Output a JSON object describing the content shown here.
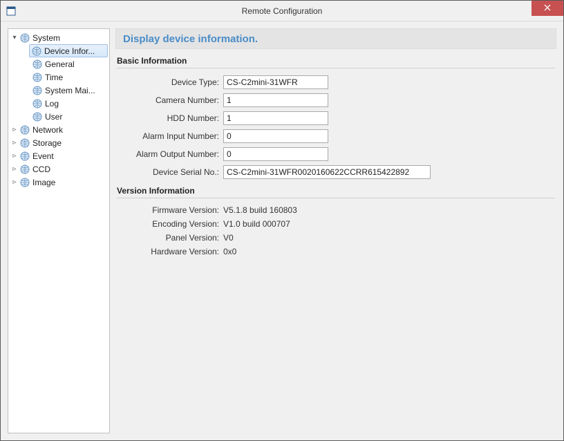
{
  "window": {
    "title": "Remote Configuration"
  },
  "tree": {
    "system": {
      "label": "System",
      "expanded": true,
      "children": {
        "device_info": "Device Infor...",
        "general": "General",
        "time": "Time",
        "system_mai": "System Mai...",
        "log": "Log",
        "user": "User"
      }
    },
    "network": {
      "label": "Network"
    },
    "storage": {
      "label": "Storage"
    },
    "event": {
      "label": "Event"
    },
    "ccd": {
      "label": "CCD"
    },
    "image": {
      "label": "Image"
    }
  },
  "content": {
    "header": "Display device information.",
    "basic_title": "Basic Information",
    "fields": {
      "device_type": {
        "label": "Device Type:",
        "value": "CS-C2mini-31WFR"
      },
      "camera_number": {
        "label": "Camera Number:",
        "value": "1"
      },
      "hdd_number": {
        "label": "HDD Number:",
        "value": "1"
      },
      "alarm_input": {
        "label": "Alarm Input Number:",
        "value": "0"
      },
      "alarm_output": {
        "label": "Alarm Output Number:",
        "value": "0"
      },
      "serial": {
        "label": "Device Serial No.:",
        "value": "CS-C2mini-31WFR0020160622CCRR615422892"
      }
    },
    "version_title": "Version Information",
    "version": {
      "firmware": {
        "label": "Firmware Version:",
        "value": "V5.1.8 build 160803"
      },
      "encoding": {
        "label": "Encoding Version:",
        "value": "V1.0 build 000707"
      },
      "panel": {
        "label": "Panel Version:",
        "value": "V0"
      },
      "hardware": {
        "label": "Hardware Version:",
        "value": "0x0"
      }
    }
  }
}
